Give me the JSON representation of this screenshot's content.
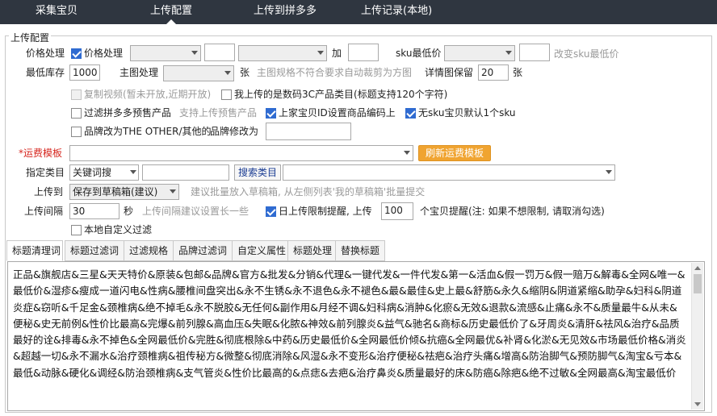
{
  "nav": {
    "tabs": [
      "采集宝贝",
      "上传配置",
      "上传到拼多多",
      "上传记录(本地)"
    ],
    "active": 1
  },
  "config": {
    "legend": "上传配置",
    "price": {
      "label": "价格处理",
      "checkbox_label": "价格处理",
      "checked": true,
      "add_label": "加",
      "sku_min_label": "sku最低价",
      "change_sku_label": "改变sku最低价"
    },
    "stock": {
      "label": "最低库存",
      "value": "1000",
      "main_image_label": "主图处理",
      "unit_zhang": "张",
      "main_image_note": "主图规格不符合要求自动裁剪为方图",
      "detail_keep_label": "详情图保留",
      "detail_keep_value": "20",
      "detail_unit": "张"
    },
    "video": {
      "label": "复制视频(暂未开放,近期开放)",
      "digital_label": "我上传的是数码3C产品类目(标题支持120个字符)"
    },
    "presale": {
      "filter_label": "过滤拼多多预售产品",
      "support_label": "支持上传预售产品",
      "outer_id_label": "上家宝贝ID设置商品编码上",
      "outer_id_checked": true,
      "default_sku_label": "无sku宝贝默认1个sku",
      "default_sku_checked": true
    },
    "brand": {
      "label": "品牌改为THE OTHER/其他的",
      "modify_label": "品牌修改为",
      "modify_value": ""
    },
    "freight": {
      "label": "运费模板",
      "required_mark": "*",
      "refresh_button": "刷新运费模板"
    },
    "category": {
      "label": "指定类目",
      "mode_value": "关键词搜",
      "search_button": "搜索类目"
    },
    "upload_to": {
      "label": "上传到",
      "value": "保存到草稿箱(建议)",
      "note": "建议批量放入草稿箱, 从左侧列表'我的草稿箱'批量提交"
    },
    "interval": {
      "label": "上传间隔",
      "value": "30",
      "unit": "秒",
      "note": "上传间隔建议设置长一些",
      "daily_limit_label": "日上传限制提醒, 上传",
      "daily_limit_checked": true,
      "daily_limit_value": "100",
      "daily_limit_note": "个宝贝提醒(注: 如果不想限制, 请取消勾选)"
    },
    "local_filter": {
      "label": "本地自定义过滤"
    }
  },
  "subtabs": [
    "标题清理词",
    "标题过滤词",
    "过滤规格",
    "品牌过滤词",
    "自定义属性",
    "标题处理",
    "替换标题"
  ],
  "subtab_active": 0,
  "title_clean_words": "正品&旗舰店&三星&天天特价&原装&包邮&品牌&官方&批发&分销&代理&一键代发&一件代发&第一&活血&假一罚万&假一赔万&解毒&全网&唯一&最低价&湿疹&瘦成一道闪电&性病&腰椎间盘突出&永不生锈&永不退色&永不褪色&最&最佳&史上最&舒筋&永久&缩阴&阴道紧缩&助孕&妇科&阴道炎症&窃听&千足金&颈椎病&绝不掉毛&永不脱胶&无任何&副作用&月经不调&妇科病&消肿&化瘀&无效&退款&流感&止痛&永不&质量最牛&从未&便秘&史无前例&性价比最高&完爆&前列腺&高血压&失眠&化脓&神效&前列腺炎&益气&驰名&商标&历史最低价了&牙周炎&清肝&祛风&治疗&品质最好的诠&排毒&永不掉色&全网最低价&完胜&彻底根除&中药&历史最低价&全网最低价倾&抗癌&全网最优&补肾&化淤&无见效&市场最低价格&消炎&超越一切&永不漏水&治疗颈椎病&祖传秘方&微整&彻底消除&风湿&永不变形&治疗便秘&祛疤&治疗头痛&增高&防治脚气&预防脚气&淘宝&亏本&最低&动脉&硬化&调经&防治颈椎病&支气管炎&性价比最高的&点痣&去疤&治疗鼻炎&质量最好的床&防癌&除疤&绝不过敏&全网最高&淘宝最低价"
}
